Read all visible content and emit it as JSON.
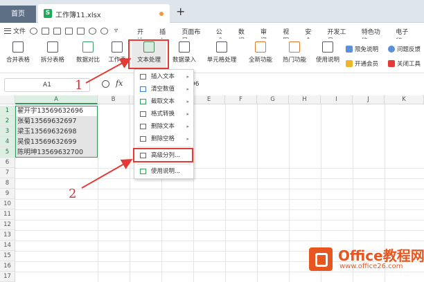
{
  "tabs": {
    "home": "首页",
    "file": "工作簿11.xlsx",
    "file_icon": "S",
    "add": "+"
  },
  "menubar": {
    "file_menu": "文件",
    "items": [
      "开始",
      "插入",
      "页面布局",
      "公式",
      "数据",
      "审阅",
      "视图",
      "安全",
      "开发工具",
      "特色功能",
      "电子印"
    ]
  },
  "ribbon": {
    "buttons": [
      "合并表格",
      "拆分表格",
      "数据对比",
      "工作表",
      "文本处理",
      "数据录入",
      "单元格处理",
      "全新功能",
      "热门功能",
      "使用说明"
    ],
    "right_items": [
      "限免说明",
      "开通会员",
      "问题反馈",
      "关闭工具"
    ]
  },
  "formula_bar": {
    "cell_ref": "A1",
    "fx": "fx",
    "value_tail": "96"
  },
  "grid": {
    "columns": [
      "A",
      "B",
      "C",
      "D",
      "E",
      "F",
      "G",
      "H",
      "I",
      "J",
      "K"
    ],
    "rows": [
      "1",
      "2",
      "3",
      "4",
      "5",
      "6",
      "7",
      "8",
      "9",
      "10",
      "11",
      "12",
      "13",
      "14",
      "15",
      "16",
      "17"
    ],
    "cells": [
      "翟开宇13569632696",
      "张菊13569632697",
      "梁玉13569632698",
      "吴俊13569632699",
      "陈明坤13569632700"
    ]
  },
  "dropdown": {
    "items": [
      "插入文本",
      "清空数值",
      "截取文本",
      "格式转换",
      "删除文本",
      "删除空格",
      "高级分列...",
      "使用说明..."
    ]
  },
  "annotations": {
    "step1": "1",
    "step2": "2"
  },
  "watermark": {
    "title": "Office教程网",
    "url": "www.office26.com"
  },
  "colors": {
    "accent_red": "#e53935",
    "selection_green": "#2e9a57",
    "brand_orange": "#e8561f"
  }
}
